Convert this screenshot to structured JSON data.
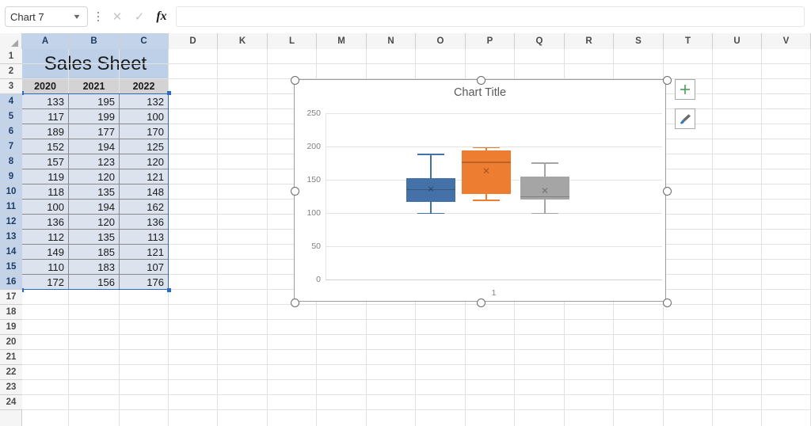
{
  "formula_bar": {
    "name_box_value": "Chart 7",
    "name_box_chevron": "chevron-down-icon",
    "kebab": "more-options-icon",
    "cancel_label": "✕",
    "enter_label": "✓",
    "fx_label": "fx",
    "formula_value": "",
    "formula_placeholder": ""
  },
  "grid": {
    "columns": [
      "A",
      "B",
      "C",
      "D",
      "K",
      "L",
      "M",
      "N",
      "O",
      "P",
      "Q",
      "R",
      "S",
      "T",
      "U",
      "V"
    ],
    "selected_columns": [
      "A",
      "B",
      "C"
    ],
    "rows": [
      1,
      2,
      3,
      4,
      5,
      6,
      7,
      8,
      9,
      10,
      11,
      12,
      13,
      14,
      15,
      16,
      17,
      18,
      19,
      20,
      21,
      22,
      23,
      24
    ],
    "selected_rows": [
      4,
      5,
      6,
      7,
      8,
      9,
      10,
      11,
      12,
      13,
      14,
      15,
      16
    ],
    "sheet_title": "Sales Sheet",
    "header_row": [
      "2020",
      "2021",
      "2022"
    ],
    "data": [
      [
        "133",
        "195",
        "132"
      ],
      [
        "117",
        "199",
        "100"
      ],
      [
        "189",
        "177",
        "170"
      ],
      [
        "152",
        "194",
        "125"
      ],
      [
        "157",
        "123",
        "120"
      ],
      [
        "119",
        "120",
        "121"
      ],
      [
        "118",
        "135",
        "148"
      ],
      [
        "100",
        "194",
        "162"
      ],
      [
        "136",
        "120",
        "136"
      ],
      [
        "112",
        "135",
        "113"
      ],
      [
        "149",
        "185",
        "121"
      ],
      [
        "110",
        "183",
        "107"
      ],
      [
        "172",
        "156",
        "176"
      ]
    ]
  },
  "chart": {
    "title": "Chart Title",
    "elements_button": "chart-elements-plus-icon",
    "styles_button": "chart-styles-brush-icon",
    "selected": true
  },
  "chart_data": {
    "type": "box",
    "title": "Chart Title",
    "xlabel": "",
    "ylabel": "",
    "categories": [
      "1"
    ],
    "ylim": [
      0,
      250
    ],
    "yticks": [
      0,
      50,
      100,
      150,
      200,
      250
    ],
    "grid": true,
    "legend": "none",
    "series": [
      {
        "name": "2020",
        "color": "#4472a8",
        "min": 100,
        "q1": 117,
        "median": 136,
        "q3": 152,
        "max": 189,
        "mean": 135.7,
        "values": [
          133,
          117,
          189,
          152,
          157,
          119,
          118,
          100,
          136,
          112,
          149,
          110,
          172
        ]
      },
      {
        "name": "2021",
        "color": "#ed7d31",
        "min": 120,
        "q1": 129,
        "median": 177,
        "q3": 194,
        "max": 199,
        "mean": 162.8,
        "values": [
          195,
          199,
          177,
          194,
          123,
          120,
          135,
          194,
          120,
          135,
          185,
          183,
          156
        ]
      },
      {
        "name": "2022",
        "color": "#a5a5a5",
        "min": 100,
        "q1": 120,
        "median": 125,
        "q3": 155,
        "max": 176,
        "mean": 133.2,
        "values": [
          132,
          100,
          170,
          125,
          120,
          121,
          148,
          162,
          136,
          113,
          121,
          107,
          176
        ]
      }
    ]
  }
}
